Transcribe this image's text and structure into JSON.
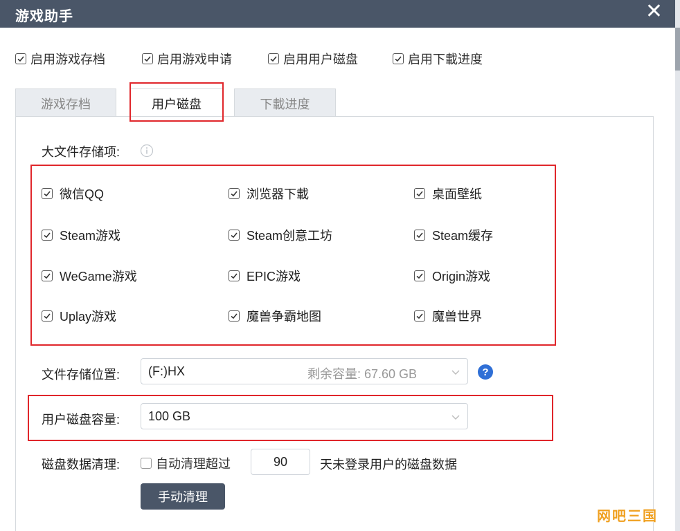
{
  "window": {
    "title": "游戏助手",
    "close_label": "✕"
  },
  "top_options": [
    {
      "label": "启用游戏存档",
      "checked": true
    },
    {
      "label": "启用游戏申请",
      "checked": true
    },
    {
      "label": "启用用户磁盘",
      "checked": true
    },
    {
      "label": "启用下載进度",
      "checked": true
    }
  ],
  "tabs": [
    {
      "label": "游戏存档",
      "active": false
    },
    {
      "label": "用户磁盘",
      "active": true
    },
    {
      "label": "下載进度",
      "active": false
    }
  ],
  "large_file": {
    "label": "大文件存储项:",
    "items": [
      {
        "label": "微信QQ",
        "checked": true
      },
      {
        "label": "浏览器下載",
        "checked": true
      },
      {
        "label": "桌面壁纸",
        "checked": true
      },
      {
        "label": "Steam游戏",
        "checked": true
      },
      {
        "label": "Steam创意工坊",
        "checked": true
      },
      {
        "label": "Steam缓存",
        "checked": true
      },
      {
        "label": "WeGame游戏",
        "checked": true
      },
      {
        "label": "EPIC游戏",
        "checked": true
      },
      {
        "label": "Origin游戏",
        "checked": true
      },
      {
        "label": "Uplay游戏",
        "checked": true
      },
      {
        "label": "魔兽争霸地图",
        "checked": true
      },
      {
        "label": "魔兽世界",
        "checked": true
      }
    ]
  },
  "storage_location": {
    "label": "文件存储位置:",
    "value": "(F:)HX",
    "hint": "剩余容量: 67.60 GB"
  },
  "disk_capacity": {
    "label": "用户磁盘容量:",
    "value": "100 GB"
  },
  "cleanup": {
    "label": "磁盘数据清理:",
    "checkbox_label": "自动清理超过",
    "checked": false,
    "days": "90",
    "suffix": "天未登录用户的磁盘数据",
    "button": "手动清理"
  },
  "watermark": "网吧三国",
  "colors": {
    "titlebar": "#4a5668",
    "highlight": "#e0262b",
    "help": "#2f6fd6",
    "watermark": "#f0a020"
  }
}
